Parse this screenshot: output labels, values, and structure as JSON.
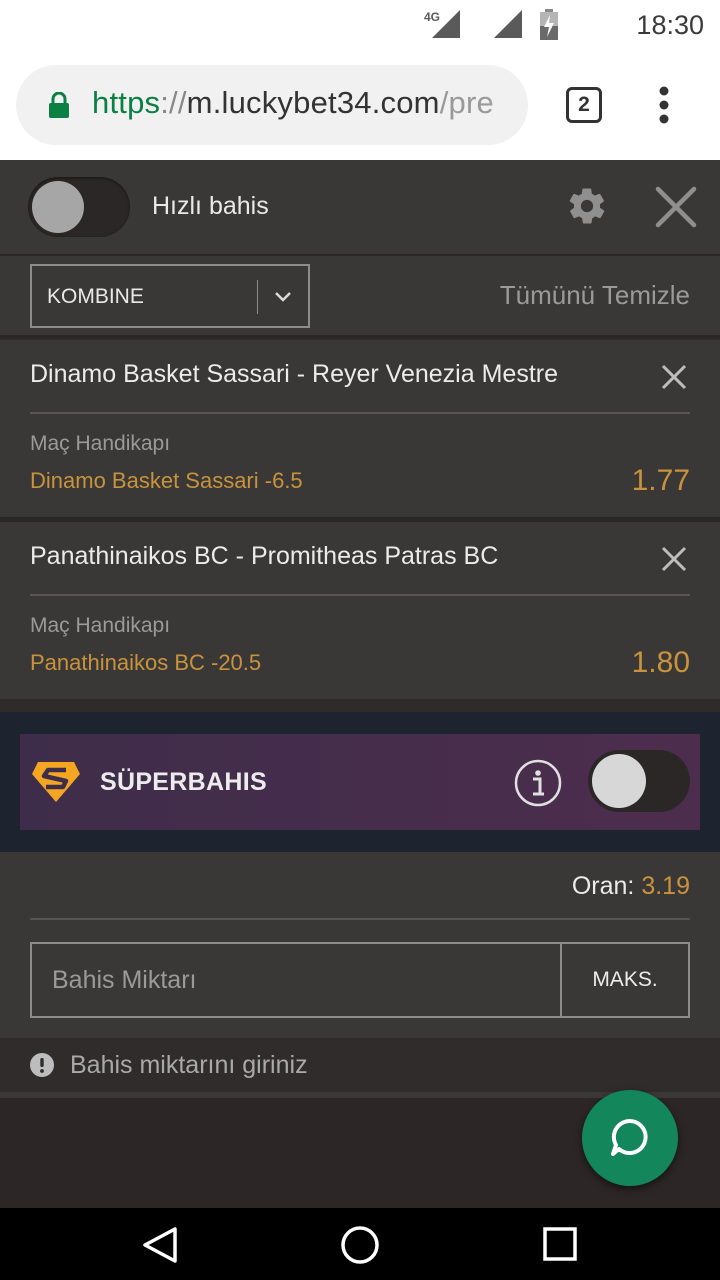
{
  "status_bar": {
    "time": "18:30",
    "network_label": "4G",
    "icons": [
      "signal-4g-icon",
      "signal-icon",
      "battery-charging-icon"
    ]
  },
  "browser": {
    "url_scheme": "https",
    "url_sep": "://",
    "url_host": "m.luckybet34.com",
    "url_path": "/pre",
    "tab_count": "2",
    "icons": [
      "lock-icon",
      "overflow-menu-icon"
    ]
  },
  "betslip": {
    "quick_bet_label": "Hızlı bahis",
    "quick_bet_on": false,
    "bet_type": "KOMBINE",
    "clear_all": "Tümünü Temizle",
    "items": [
      {
        "match": "Dinamo Basket Sassari - Reyer Venezia Mestre",
        "market": "Maç Handikapı",
        "selection": "Dinamo Basket Sassari -6.5",
        "odds": "1.77"
      },
      {
        "match": "Panathinaikos BC - Promitheas Patras BC",
        "market": "Maç Handikapı",
        "selection": "Panathinaikos BC -20.5",
        "odds": "1.80"
      }
    ],
    "superbahis": {
      "label": "SÜPERBAHIS",
      "enabled": false
    },
    "total_odds_label": "Oran:",
    "total_odds_value": "3.19",
    "stake_placeholder": "Bahis Miktarı",
    "max_button": "MAKS.",
    "warning": "Bahis miktarını giriniz"
  },
  "colors": {
    "accent_gold": "#c8933c",
    "panel": "#3a3837",
    "fab_green": "#14865b",
    "url_green": "#0b8043"
  }
}
